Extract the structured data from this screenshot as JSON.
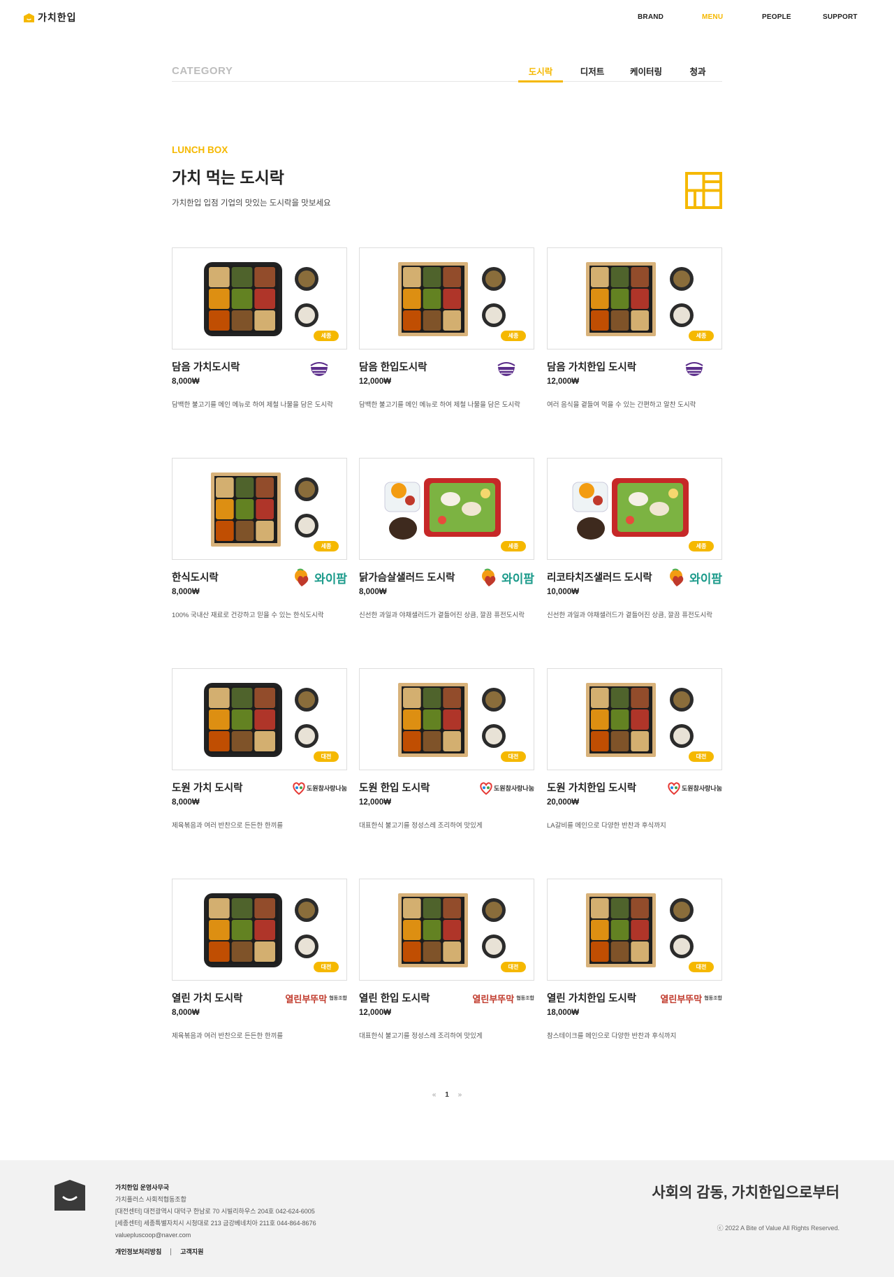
{
  "header": {
    "logo_text": "가치한입",
    "nav": [
      {
        "label": "BRAND",
        "active": false
      },
      {
        "label": "MENU",
        "active": true
      },
      {
        "label": "PEOPLE",
        "active": false
      },
      {
        "label": "SUPPORT",
        "active": false
      }
    ]
  },
  "category": {
    "title": "CATEGORY",
    "tabs": [
      {
        "label": "도시락",
        "active": true
      },
      {
        "label": "디저트",
        "active": false
      },
      {
        "label": "케이터링",
        "active": false
      },
      {
        "label": "청과",
        "active": false
      }
    ]
  },
  "intro": {
    "subtitle": "LUNCH BOX",
    "title": "가치 먹는 도시락",
    "description": "가치한입 입점 기업의 맛있는 도시락을 맛보세요"
  },
  "products": [
    {
      "name": "담음 가치도시락",
      "price": "8,000₩",
      "description": "담백한 불고기를 메인 메뉴로 하여 제철 나물을 담은 도시락",
      "region": "세종",
      "brand": "damum"
    },
    {
      "name": "담음 한입도시락",
      "price": "12,000₩",
      "description": "담백한 불고기를 메인 메뉴로 하여 제철 나물을 담은 도시락",
      "region": "세종",
      "brand": "damum"
    },
    {
      "name": "담음 가치한입 도시락",
      "price": "12,000₩",
      "description": "여러 음식을 곁들여 먹을 수 있는 간편하고 알찬 도시락",
      "region": "세종",
      "brand": "damum"
    },
    {
      "name": "한식도시락",
      "price": "8,000₩",
      "description": "100% 국내산 재료로 건강하고 믿을 수 있는 한식도시락",
      "region": "세종",
      "brand": "wifarm"
    },
    {
      "name": "닭가슴살샐러드 도시락",
      "price": "8,000₩",
      "description": "신선한 과일과 야채샐러드가 곁들어진 상큼, 깔끔 퓨전도시락",
      "region": "세종",
      "brand": "wifarm"
    },
    {
      "name": "리코타치즈샐러드 도시락",
      "price": "10,000₩",
      "description": "신선한 과일과 야채샐러드가 곁들어진 상큼, 깔끔 퓨전도시락",
      "region": "세종",
      "brand": "wifarm"
    },
    {
      "name": "도원 가치 도시락",
      "price": "8,000₩",
      "description": "제육볶음과 여러 반찬으로 든든한 한끼를",
      "region": "대전",
      "brand": "dowon"
    },
    {
      "name": "도원 한입 도시락",
      "price": "12,000₩",
      "description": "대표한식 불고기를 정성스레 조리하여 맛있게",
      "region": "대전",
      "brand": "dowon"
    },
    {
      "name": "도원 가치한입 도시락",
      "price": "20,000₩",
      "description": "LA갈비를 메인으로 다양한 반찬과 후식까지",
      "region": "대전",
      "brand": "dowon"
    },
    {
      "name": "열린 가치 도시락",
      "price": "8,000₩",
      "description": "제육볶음과 여러 반찬으로 든든한 한끼를",
      "region": "대전",
      "brand": "yeollin"
    },
    {
      "name": "열린 한입 도시락",
      "price": "12,000₩",
      "description": "대표한식 불고기를 정성스레 조리하여 맛있게",
      "region": "대전",
      "brand": "yeollin"
    },
    {
      "name": "열린 가치한입 도시락",
      "price": "18,000₩",
      "description": "참스테이크를 메인으로 다양한 반찬과 후식까지",
      "region": "대전",
      "brand": "yeollin"
    }
  ],
  "brands": {
    "damum": {
      "text": "",
      "color": "#5b2d8a"
    },
    "wifarm": {
      "text": "와이팜",
      "color": "#1a9a8a"
    },
    "dowon": {
      "text": "도원참사랑나눔",
      "color": "#333333"
    },
    "yeollin": {
      "text": "열린부뚜막",
      "color": "#c0392b",
      "suffix": "협동조합"
    }
  },
  "pagination": {
    "prev": "«",
    "current": "1",
    "next": "»"
  },
  "footer": {
    "office": "가치한입 운영사무국",
    "org": "가치플러스 사회적협동조합",
    "daejeon": "[대전센터] 대전광역시 대덕구 한남로 70 시빌리하우스 204호 042-624-6005",
    "sejong": "[세종센터] 세종특별자치시 시청대로 213 금강베네치아 211호 044-864-8676",
    "email": "valuepluscoop@naver.com",
    "link_privacy": "개인정보처리방침",
    "link_support": "고객지원",
    "slogan": "사회의 감동, 가치한입으로부터",
    "copyright": "ⓒ 2022 A Bite of Value All Rights Reserved."
  },
  "colors": {
    "accent": "#f5b800",
    "footer_bg": "#f2f2f2"
  }
}
